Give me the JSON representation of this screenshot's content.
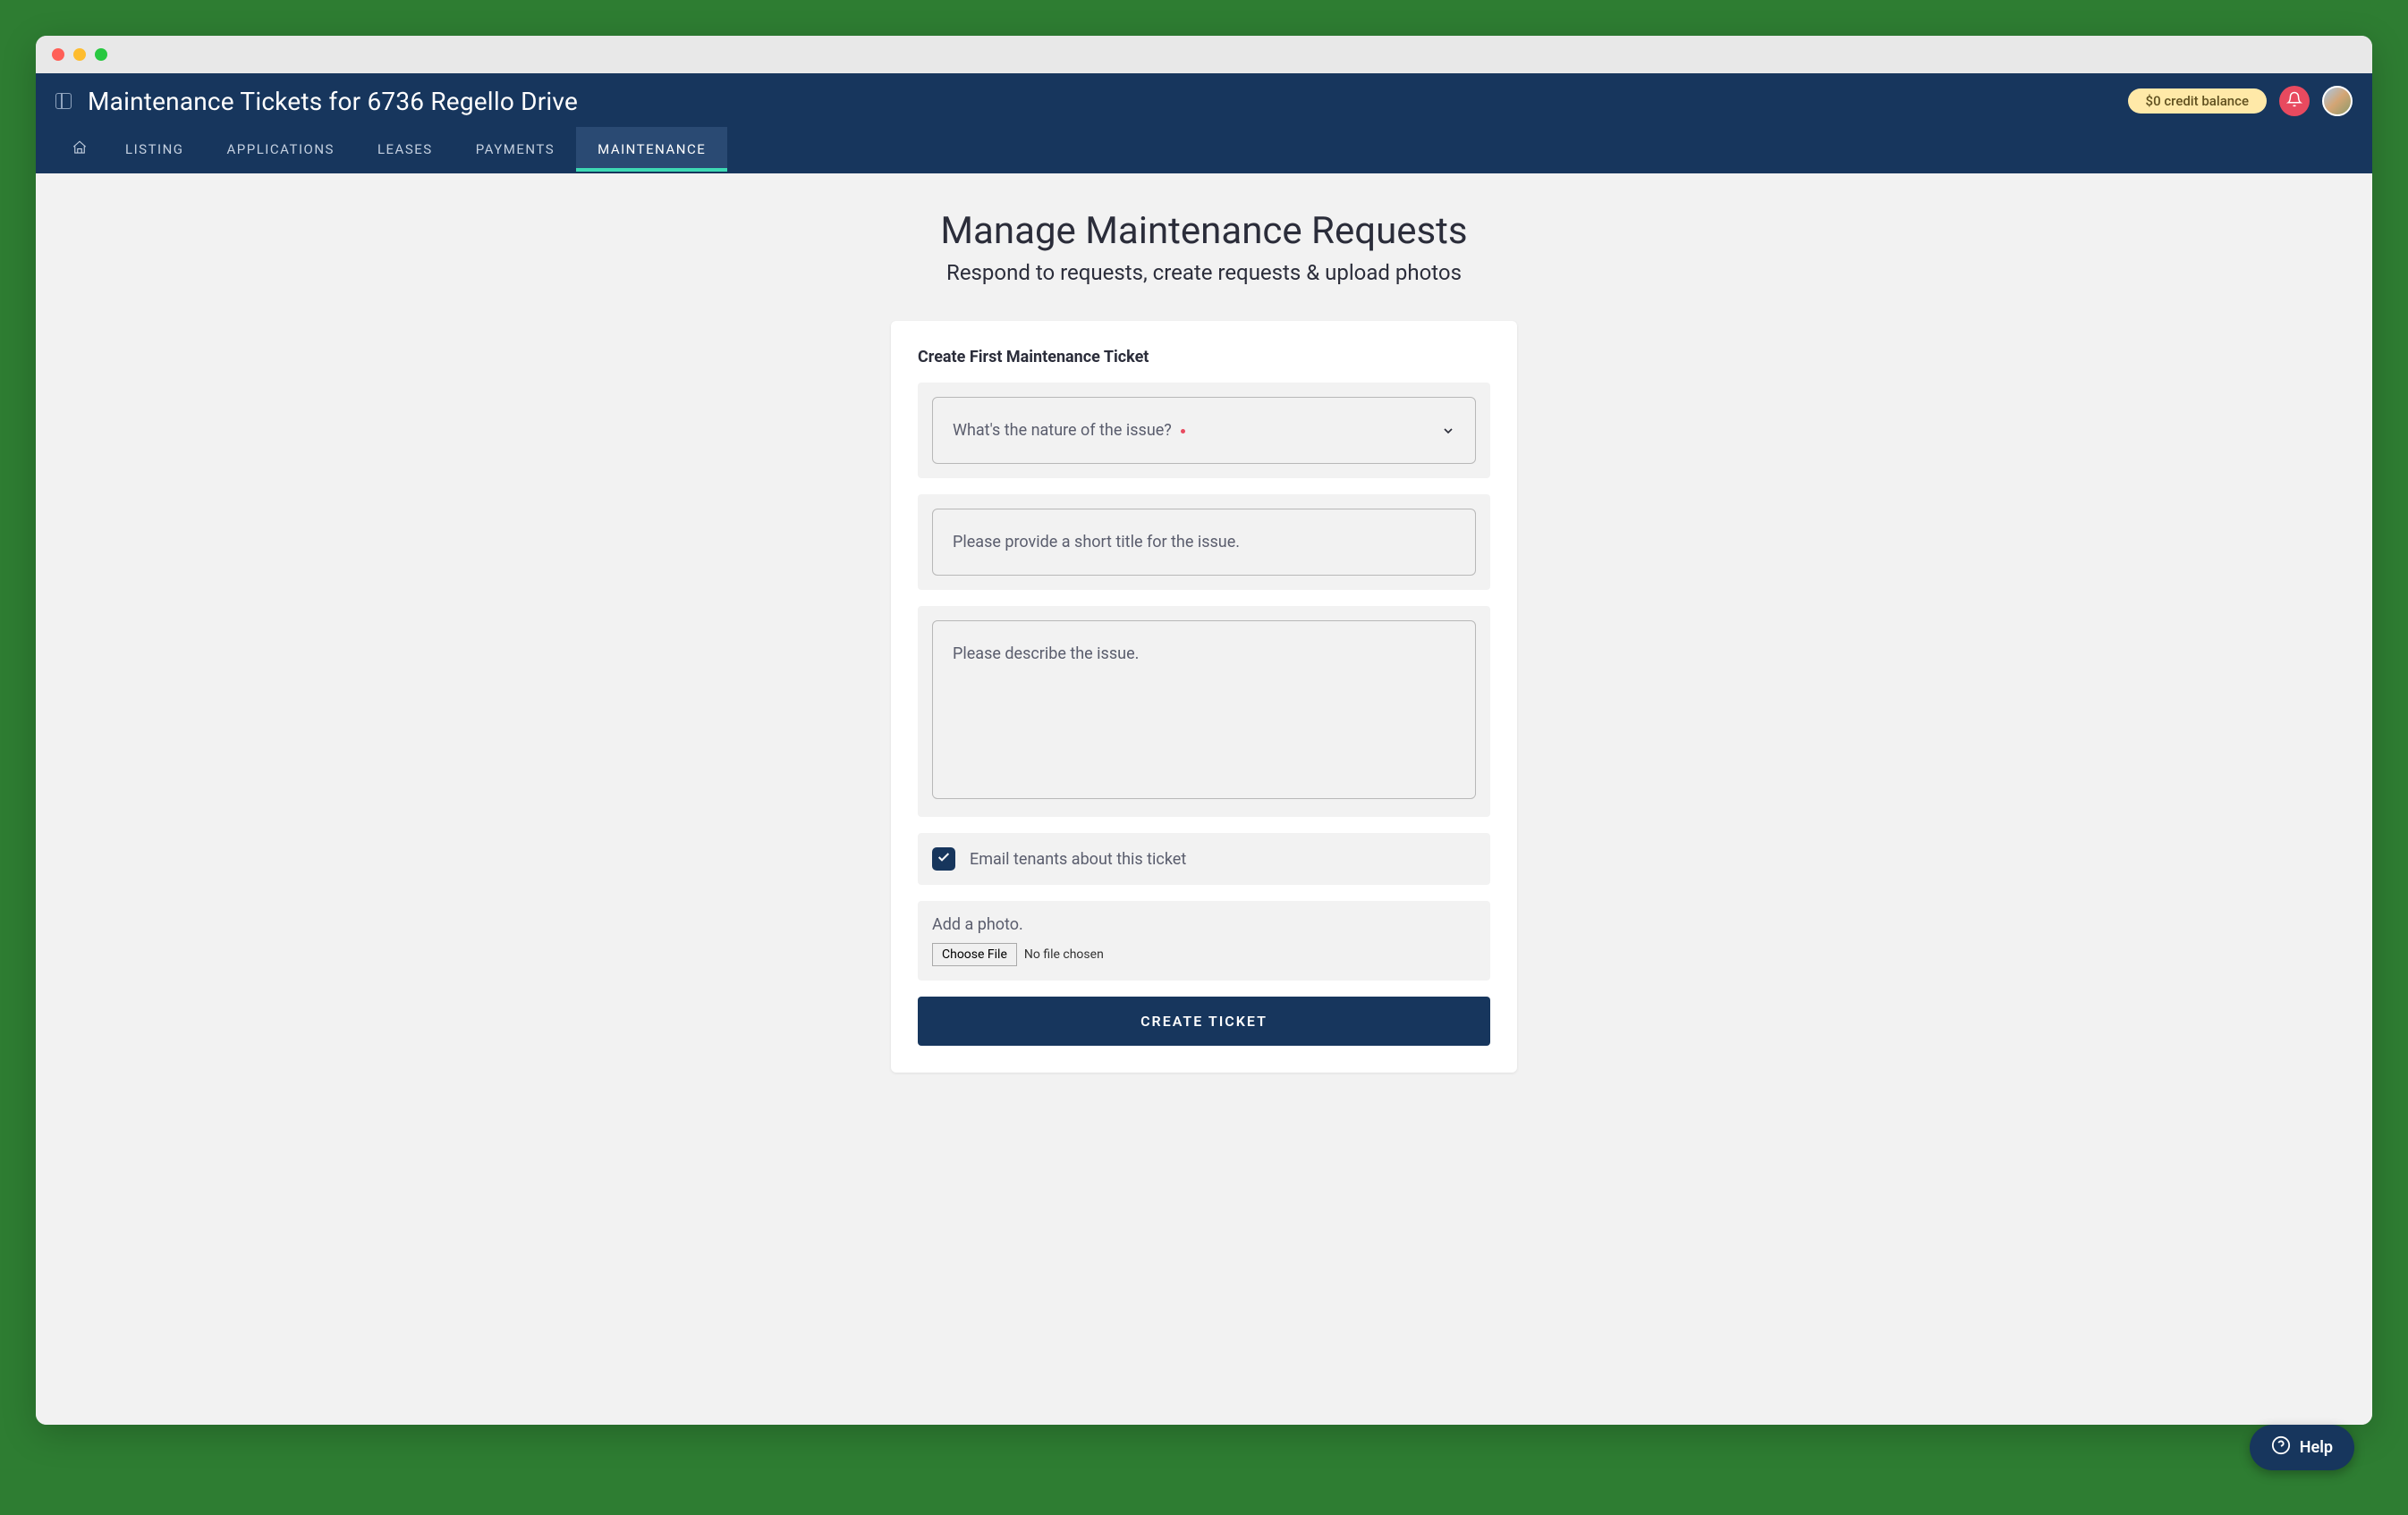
{
  "header": {
    "title": "Maintenance Tickets for 6736 Regello Drive",
    "credit_badge": "$0 credit balance"
  },
  "nav": {
    "tabs": [
      {
        "label": "LISTING"
      },
      {
        "label": "APPLICATIONS"
      },
      {
        "label": "LEASES"
      },
      {
        "label": "PAYMENTS"
      },
      {
        "label": "MAINTENANCE"
      }
    ]
  },
  "content": {
    "title": "Manage Maintenance Requests",
    "subtitle": "Respond to requests, create requests & upload photos"
  },
  "form": {
    "card_title": "Create First Maintenance Ticket",
    "issue_nature_label": "What's the nature of the issue?",
    "title_placeholder": "Please provide a short title for the issue.",
    "description_placeholder": "Please describe the issue.",
    "email_tenants_label": "Email tenants about this ticket",
    "email_tenants_checked": true,
    "photo_label": "Add a photo.",
    "choose_file_label": "Choose File",
    "file_status": "No file chosen",
    "submit_label": "CREATE TICKET"
  },
  "help": {
    "label": "Help"
  }
}
